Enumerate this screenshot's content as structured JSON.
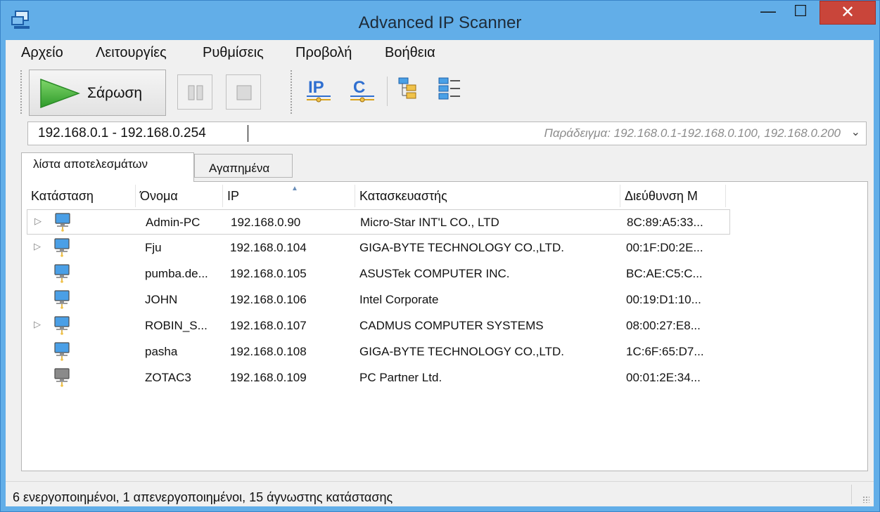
{
  "window": {
    "title": "Advanced IP Scanner",
    "close_glyph": "✕",
    "min_glyph": "—",
    "max_glyph": "☐"
  },
  "menu": [
    "Αρχείο",
    "Λειτουργίες",
    "Ρυθμίσεις",
    "Προβολή",
    "Βοήθεια"
  ],
  "toolbar": {
    "scan_label": "Σάρωση",
    "icons": [
      "play-icon",
      "pause-icon",
      "stop-icon",
      "ip-icon",
      "c-icon",
      "expand-all-icon",
      "collapse-all-icon"
    ]
  },
  "address": {
    "value": "192.168.0.1 - 192.168.0.254",
    "placeholder": "Παράδειγμα: 192.168.0.1-192.168.0.100, 192.168.0.200",
    "dropdown_glyph": "⌄"
  },
  "tabs": [
    {
      "label": "λίστα αποτελεσμάτων",
      "active": true
    },
    {
      "label": "Αγαπημένα",
      "active": false
    }
  ],
  "table": {
    "columns": [
      "Κατάσταση",
      "Όνομα",
      "IP",
      "Κατασκευαστής",
      "Διεύθυνση M"
    ],
    "sort_glyph": "▲",
    "rows": [
      {
        "expandable": true,
        "online": true,
        "name": "Admin-PC",
        "ip": "192.168.0.90",
        "vendor": "Micro-Star INT'L CO., LTD",
        "mac": "8C:89:A5:33..."
      },
      {
        "expandable": true,
        "online": true,
        "name": "Fju",
        "ip": "192.168.0.104",
        "vendor": "GIGA-BYTE TECHNOLOGY CO.,LTD.",
        "mac": "00:1F:D0:2E..."
      },
      {
        "expandable": false,
        "online": true,
        "name": "pumba.de...",
        "ip": "192.168.0.105",
        "vendor": "ASUSTek COMPUTER INC.",
        "mac": "BC:AE:C5:C..."
      },
      {
        "expandable": false,
        "online": true,
        "name": "JOHN",
        "ip": "192.168.0.106",
        "vendor": "Intel Corporate",
        "mac": "00:19:D1:10..."
      },
      {
        "expandable": true,
        "online": true,
        "name": "ROBIN_S...",
        "ip": "192.168.0.107",
        "vendor": "CADMUS COMPUTER SYSTEMS",
        "mac": "08:00:27:E8..."
      },
      {
        "expandable": false,
        "online": true,
        "name": "pasha",
        "ip": "192.168.0.108",
        "vendor": "GIGA-BYTE TECHNOLOGY CO.,LTD.",
        "mac": "1C:6F:65:D7..."
      },
      {
        "expandable": false,
        "online": false,
        "name": "ZOTAC3",
        "ip": "192.168.0.109",
        "vendor": "PC Partner Ltd.",
        "mac": "00:01:2E:34..."
      }
    ]
  },
  "status": {
    "text": "6 ενεργοποιημένοι, 1 απενεργοποιημένοι, 15 άγνωστης κατάστασης"
  },
  "colors": {
    "title_bg": "#62aee8",
    "close_bg": "#c9453a",
    "online_screen": "#4a9fe6",
    "offline_screen": "#8a8a8a",
    "ip_icon": "#2f6fd0"
  }
}
